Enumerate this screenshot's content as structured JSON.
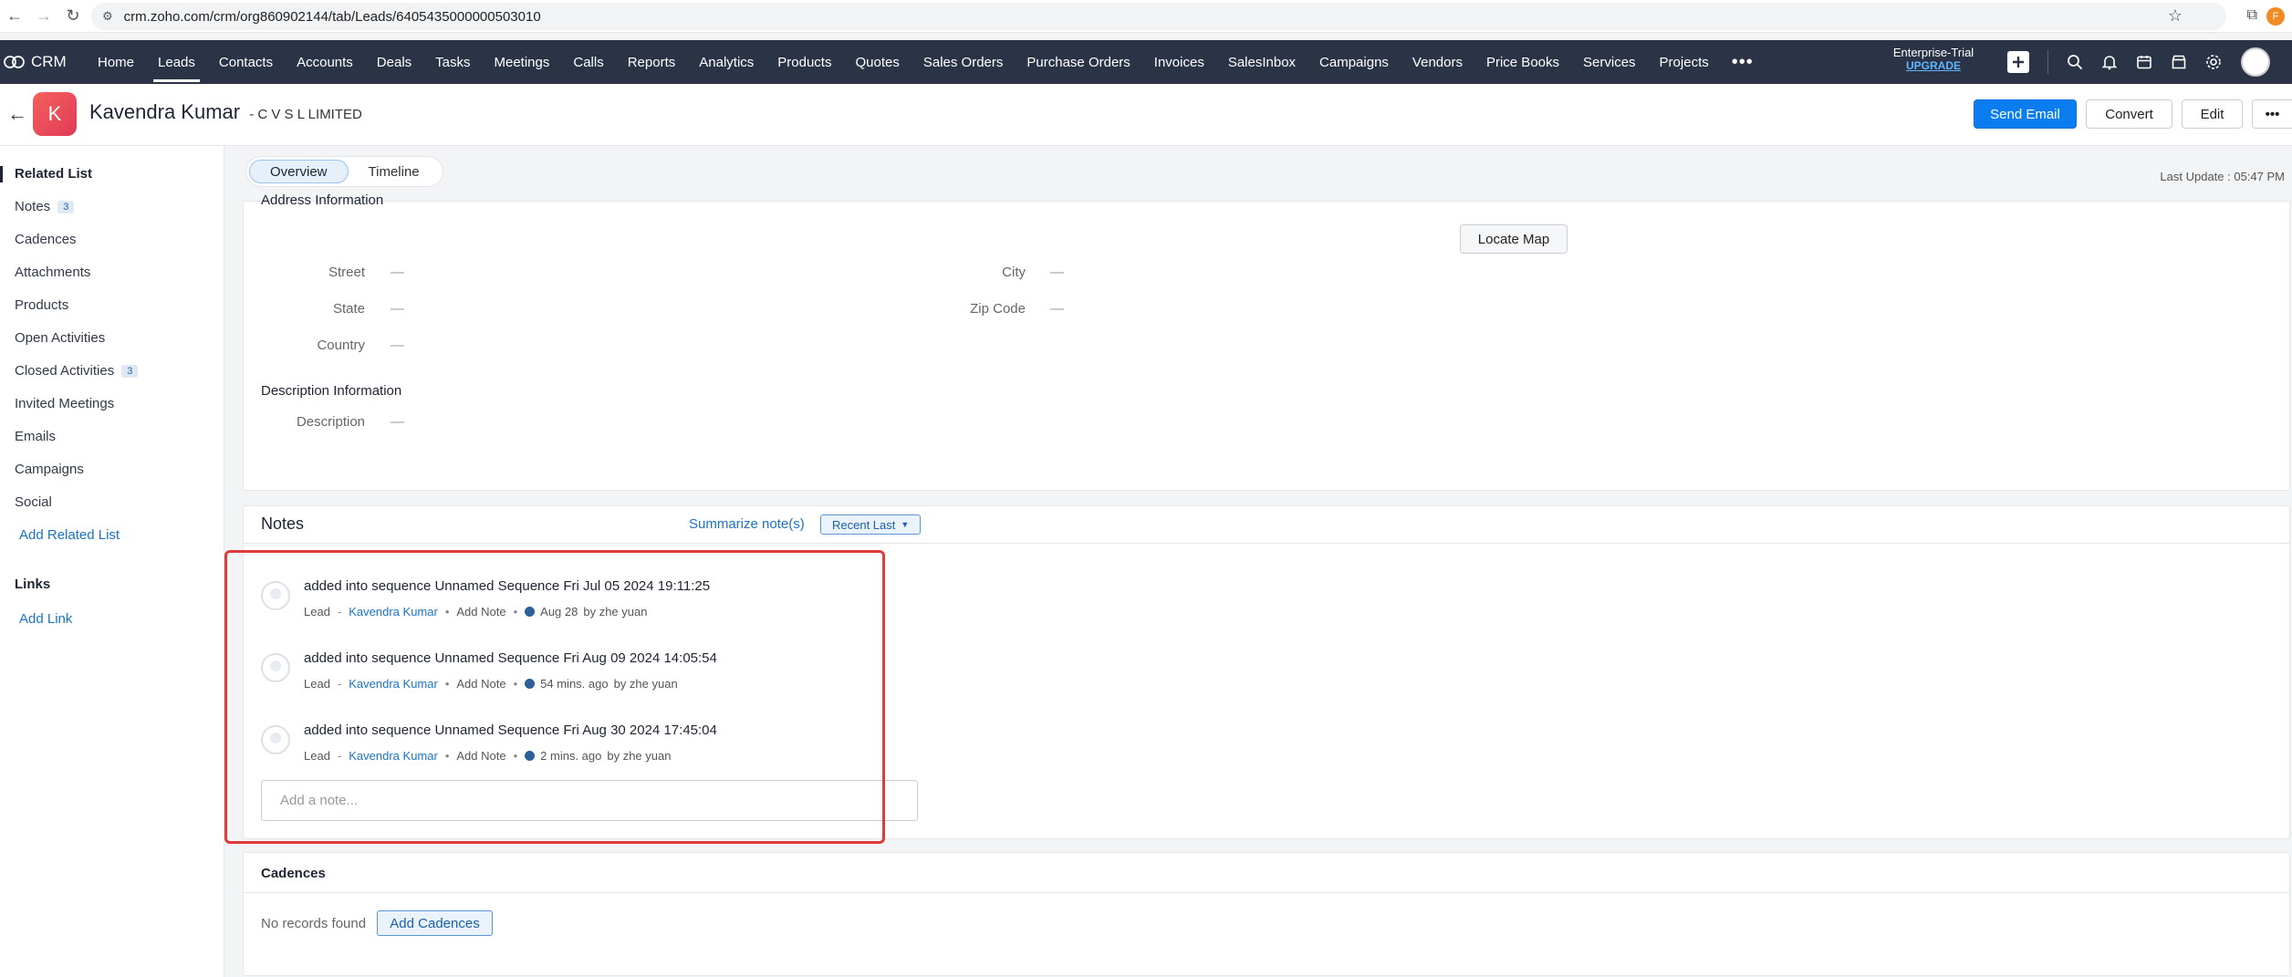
{
  "browser": {
    "url": "crm.zoho.com/crm/org860902144/tab/Leads/6405435000000503010",
    "profile_letter": "F"
  },
  "nav": {
    "logo": "CRM",
    "items": [
      "Home",
      "Leads",
      "Contacts",
      "Accounts",
      "Deals",
      "Tasks",
      "Meetings",
      "Calls",
      "Reports",
      "Analytics",
      "Products",
      "Quotes",
      "Sales Orders",
      "Purchase Orders",
      "Invoices",
      "SalesInbox",
      "Campaigns",
      "Vendors",
      "Price Books",
      "Services",
      "Projects"
    ],
    "more": "•••",
    "trial_label": "Enterprise-Trial",
    "upgrade_label": "UPGRADE"
  },
  "record": {
    "avatar_letter": "K",
    "name": "Kavendra Kumar",
    "company": "- C V S L LIMITED",
    "send_email": "Send Email",
    "convert": "Convert",
    "edit": "Edit",
    "more": "•••"
  },
  "sidebar": {
    "related_title": "Related List",
    "items": [
      {
        "label": "Notes",
        "badge": "3"
      },
      {
        "label": "Cadences"
      },
      {
        "label": "Attachments"
      },
      {
        "label": "Products"
      },
      {
        "label": "Open Activities"
      },
      {
        "label": "Closed Activities",
        "badge": "3"
      },
      {
        "label": "Invited Meetings"
      },
      {
        "label": "Emails"
      },
      {
        "label": "Campaigns"
      },
      {
        "label": "Social"
      }
    ],
    "add_related": "Add Related List",
    "links_title": "Links",
    "add_link": "Add Link"
  },
  "tabs": {
    "overview": "Overview",
    "timeline": "Timeline",
    "last_update": "Last Update : 05:47 PM"
  },
  "address": {
    "heading": "Address Information",
    "locate_map": "Locate Map",
    "street_label": "Street",
    "street_value": "—",
    "state_label": "State",
    "state_value": "—",
    "country_label": "Country",
    "country_value": "—",
    "city_label": "City",
    "city_value": "—",
    "zip_label": "Zip Code",
    "zip_value": "—"
  },
  "description": {
    "heading": "Description Information",
    "label": "Description",
    "value": "—"
  },
  "notes": {
    "title": "Notes",
    "summarize": "Summarize note(s)",
    "sort": "Recent Last",
    "items": [
      {
        "text": "added into sequence Unnamed Sequence Fri Jul 05 2024 19:11:25",
        "type": "Lead",
        "link": "Kavendra Kumar",
        "action": "Add Note",
        "time": "Aug 28",
        "by": "by  zhe yuan"
      },
      {
        "text": "added into sequence Unnamed Sequence Fri Aug 09 2024 14:05:54",
        "type": "Lead",
        "link": "Kavendra Kumar",
        "action": "Add Note",
        "time": "54 mins. ago",
        "by": "by  zhe yuan"
      },
      {
        "text": "added into sequence Unnamed Sequence Fri Aug 30 2024 17:45:04",
        "type": "Lead",
        "link": "Kavendra Kumar",
        "action": "Add Note",
        "time": "2 mins. ago",
        "by": "by  zhe yuan"
      }
    ],
    "add_placeholder": "Add a note..."
  },
  "cadences": {
    "title": "Cadences",
    "empty": "No records found",
    "add_button": "Add Cadences"
  }
}
